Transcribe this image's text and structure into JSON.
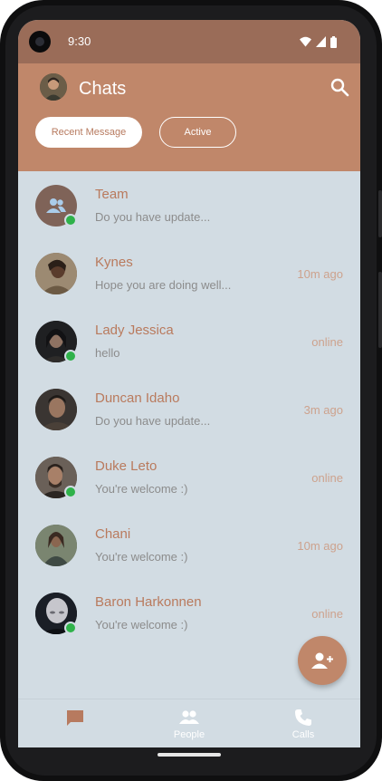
{
  "status_bar": {
    "time": "9:30"
  },
  "app_bar": {
    "title": "Chats"
  },
  "filters": {
    "recent_label": "Recent Message",
    "active_label": "Active"
  },
  "chats": [
    {
      "name": "Team",
      "message": "Do you have update...",
      "meta": "",
      "online": true,
      "avatar_color": "#7f6358"
    },
    {
      "name": "Kynes",
      "message": "Hope you are doing well...",
      "meta": "10m ago",
      "online": false,
      "avatar_color": "#6f5a4a"
    },
    {
      "name": "Lady Jessica",
      "message": "hello",
      "meta": "online",
      "online": true,
      "avatar_color": "#2b2b2e"
    },
    {
      "name": "Duncan Idaho",
      "message": "Do you have update...",
      "meta": "3m ago",
      "online": false,
      "avatar_color": "#5a4a40"
    },
    {
      "name": "Duke Leto",
      "message": "You're welcome :)",
      "meta": "online",
      "online": true,
      "avatar_color": "#4a3f38"
    },
    {
      "name": "Chani",
      "message": "You're welcome :)",
      "meta": "10m ago",
      "online": false,
      "avatar_color": "#4f5a52"
    },
    {
      "name": "Baron Harkonnen",
      "message": "You're welcome :)",
      "meta": "online",
      "online": true,
      "avatar_color": "#1e2228"
    }
  ],
  "bottom_nav": {
    "chats_label": "",
    "people_label": "People",
    "calls_label": "Calls"
  },
  "colors": {
    "accent": "#c0876a",
    "online": "#2fb24a",
    "background": "#d2dce3"
  }
}
